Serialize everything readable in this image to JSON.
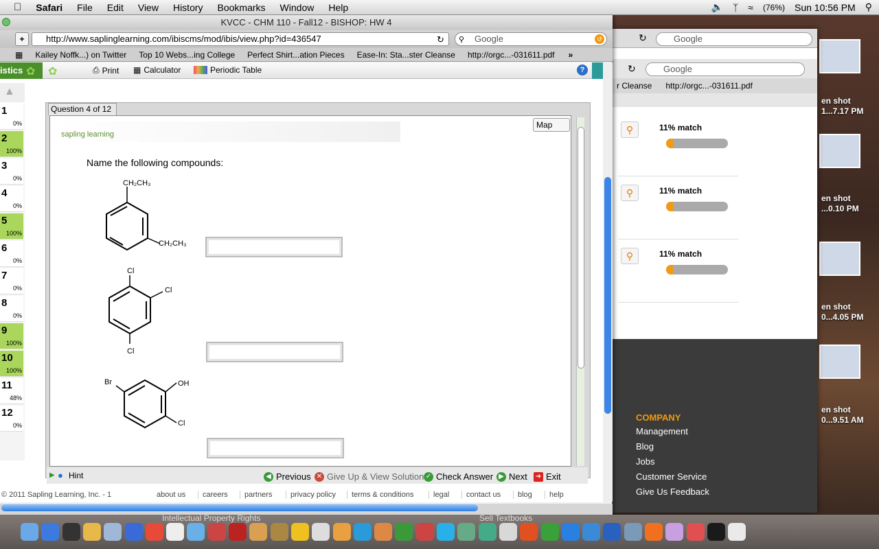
{
  "menubar": {
    "app": "Safari",
    "items": [
      "File",
      "Edit",
      "View",
      "History",
      "Bookmarks",
      "Window",
      "Help"
    ],
    "battery": "(76%)",
    "clock": "Sun 10:56 PM"
  },
  "window": {
    "title": "KVCC - CHM 110 - Fall12 - BISHOP: HW 4",
    "url": "http://www.saplinglearning.com/ibiscms/mod/ibis/view.php?id=436547",
    "search_placeholder": "Google",
    "bookmarks": [
      "Kailey Noffk...) on Twitter",
      "Top 10 Webs...ing College",
      "Perfect Shirt...ation Pieces",
      "Ease-In: Sta...ster Cleanse",
      "http://orgc...-031611.pdf"
    ]
  },
  "app": {
    "brand_fragment": "istics",
    "toolbar": {
      "print": "Print",
      "calculator": "Calculator",
      "periodic": "Periodic Table"
    },
    "question_tab": "Question 4 of 12",
    "map_label": "Map",
    "logo": "sapling learning",
    "prompt": "Name the following compounds:",
    "compounds": [
      {
        "labels": [
          "CH₂CH₃",
          "CH₂CH₃"
        ]
      },
      {
        "labels": [
          "Cl",
          "Cl",
          "Cl"
        ]
      },
      {
        "labels": [
          "Br",
          "OH",
          "Cl"
        ]
      }
    ],
    "answers": [
      "",
      "",
      ""
    ],
    "questions": [
      {
        "n": "1",
        "pct": "0%",
        "done": false
      },
      {
        "n": "2",
        "pct": "100%",
        "done": true
      },
      {
        "n": "3",
        "pct": "0%",
        "done": false
      },
      {
        "n": "4",
        "pct": "0%",
        "done": false
      },
      {
        "n": "5",
        "pct": "100%",
        "done": true
      },
      {
        "n": "6",
        "pct": "0%",
        "done": false
      },
      {
        "n": "7",
        "pct": "0%",
        "done": false
      },
      {
        "n": "8",
        "pct": "0%",
        "done": false
      },
      {
        "n": "9",
        "pct": "100%",
        "done": true
      },
      {
        "n": "10",
        "pct": "100%",
        "done": true
      },
      {
        "n": "11",
        "pct": "48%",
        "done": false
      },
      {
        "n": "12",
        "pct": "0%",
        "done": false
      }
    ],
    "hint": "Hint",
    "nav": {
      "previous": "Previous",
      "giveup": "Give Up & View Solution",
      "check": "Check Answer",
      "next": "Next",
      "exit": "Exit"
    },
    "copyright": "© 2011 Sapling Learning, Inc. - 1",
    "footer_links": [
      "about us",
      "careers",
      "partners",
      "privacy policy",
      "terms & conditions",
      "legal",
      "contact us",
      "blog",
      "help"
    ]
  },
  "backwindow": {
    "search_placeholder": "Google",
    "bookmarks": [
      "r Cleanse",
      "http://orgc...-031611.pdf"
    ],
    "matches": [
      {
        "label": "11% match",
        "value": 0.11
      },
      {
        "label": "11% match",
        "value": 0.11
      },
      {
        "label": "11% match",
        "value": 0.11
      }
    ],
    "footer": {
      "heading": "COMPANY",
      "links": [
        "Management",
        "Blog",
        "Jobs",
        "Customer Service",
        "Give Us Feedback"
      ]
    },
    "dock_text": [
      "Intellectual Property Rights",
      "Sell Textbooks"
    ]
  },
  "desktop": {
    "thumbs": [
      {
        "l1": "en shot",
        "l2": "1...7.17 PM"
      },
      {
        "l1": "en shot",
        "l2": "...0.10 PM"
      },
      {
        "l1": "en shot",
        "l2": "0...4.05 PM"
      },
      {
        "l1": "en shot",
        "l2": "0...9.51 AM"
      }
    ]
  },
  "colors": {
    "accent": "#a9d65b",
    "orange": "#f19a12",
    "blue": "#2f7de0"
  }
}
